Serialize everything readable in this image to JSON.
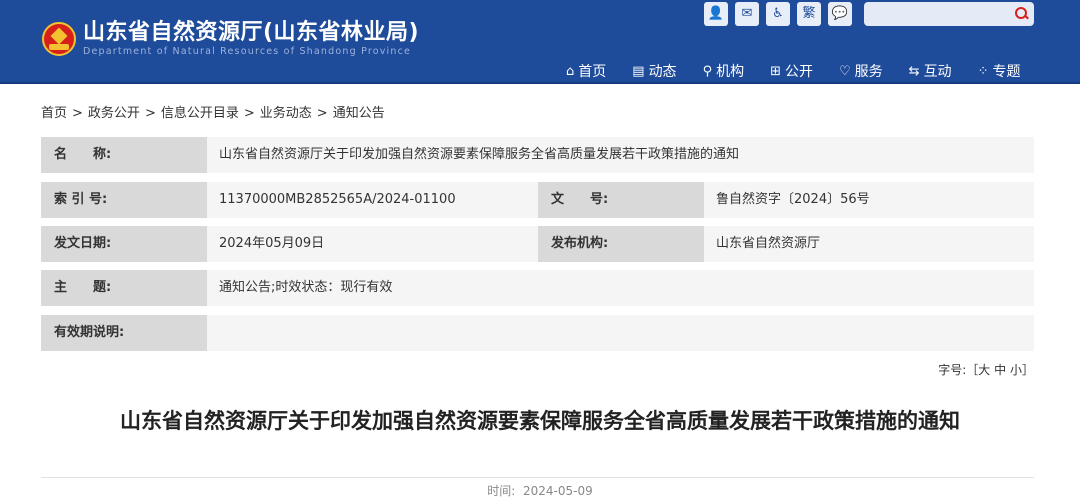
{
  "header": {
    "title": "山东省自然资源厅(山东省林业局)",
    "subtitle": "Department of Natural Resources of Shandong Province",
    "tools": [
      {
        "name": "user-icon",
        "glyph": "👤"
      },
      {
        "name": "mail-icon",
        "glyph": "✉"
      },
      {
        "name": "accessibility-icon",
        "glyph": "♿"
      },
      {
        "name": "traditional-chinese-button",
        "glyph": "繁"
      },
      {
        "name": "wechat-icon",
        "glyph": "💬"
      }
    ],
    "search": {
      "placeholder": ""
    },
    "nav": [
      {
        "icon": "⌂",
        "label": "首页"
      },
      {
        "icon": "▤",
        "label": "动态"
      },
      {
        "icon": "⚲",
        "label": "机构"
      },
      {
        "icon": "⊞",
        "label": "公开"
      },
      {
        "icon": "♡",
        "label": "服务"
      },
      {
        "icon": "⇆",
        "label": "互动"
      },
      {
        "icon": "⁘",
        "label": "专题"
      }
    ]
  },
  "breadcrumb": [
    "首页",
    "政务公开",
    "信息公开目录",
    "业务动态",
    "通知公告"
  ],
  "meta": {
    "name_label": "名　　称:",
    "name_value": "山东省自然资源厅关于印发加强自然资源要素保障服务全省高质量发展若干政策措施的通知",
    "index_label": "索 引 号:",
    "index_value": "11370000MB2852565A/2024-01100",
    "docno_label": "文　　号:",
    "docno_value": "鲁自然资字〔2024〕56号",
    "date_label": "发文日期:",
    "date_value": "2024年05月09日",
    "org_label": "发布机构:",
    "org_value": "山东省自然资源厅",
    "subject_label": "主　　题:",
    "subject_value": "通知公告;时效状态：现行有效",
    "validity_label": "有效期说明:",
    "validity_value": ""
  },
  "fontsize": {
    "prefix": "字号:［",
    "large": "大",
    "medium": "中",
    "small": "小",
    "suffix": "］"
  },
  "article": {
    "title": "山东省自然资源厅关于印发加强自然资源要素保障服务全省高质量发展若干政策措施的通知",
    "time_label": "时间:",
    "time_value": "2024-05-09"
  }
}
